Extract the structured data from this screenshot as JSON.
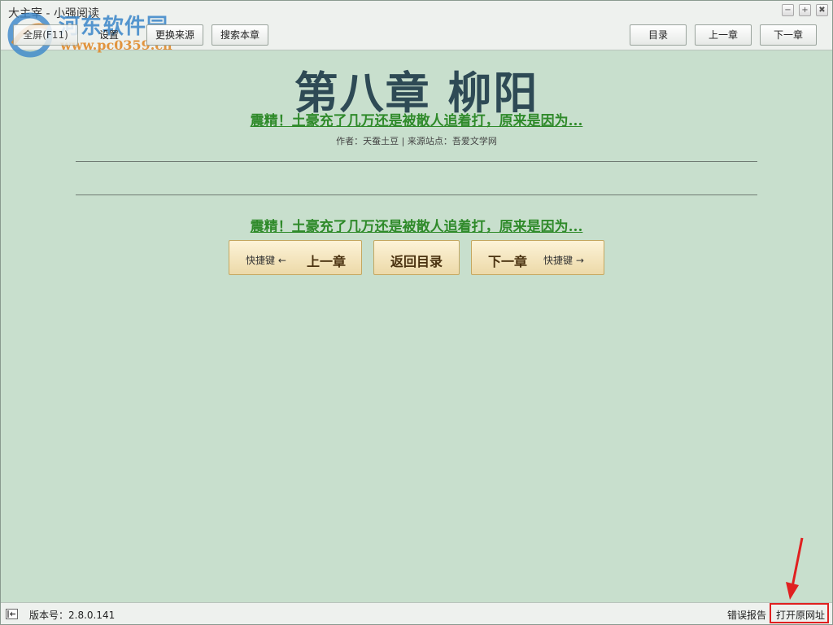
{
  "window": {
    "title": "大主宰 - 小强阅读",
    "controls": {
      "minimize": "−",
      "maximize": "+",
      "close": "✖"
    }
  },
  "watermark": {
    "name": "河东软件园",
    "url": "www.pc0359.cn"
  },
  "toolbar": {
    "fullscreen_label": "全屏(F11)",
    "settings_label": "设置",
    "change_source_label": "更换来源",
    "search_chapter_label": "搜索本章",
    "toc_label": "目录",
    "prev_label": "上一章",
    "next_label": "下一章"
  },
  "chapter": {
    "title": "第八章 柳阳",
    "ad_top": "震精！土豪充了几万还是被散人追着打，原来是因为...",
    "meta": "作者：天蚕土豆 | 来源站点：吾爱文学网",
    "ad_bottom": "震精！土豪充了几万还是被散人追着打，原来是因为..."
  },
  "nav": {
    "prev_hint": "快捷键 ←",
    "prev_label": "上一章",
    "toc_label": "返回目录",
    "next_label": "下一章",
    "next_hint": "快捷键 →"
  },
  "status": {
    "version": "版本号：2.8.0.141",
    "error_report": "错误报告",
    "open_original": "打开原网址"
  },
  "colors": {
    "reading_background": "#c8dfcd",
    "title": "#2e4a55",
    "ad_link": "#2f8a2a",
    "highlight": "#e02020"
  }
}
